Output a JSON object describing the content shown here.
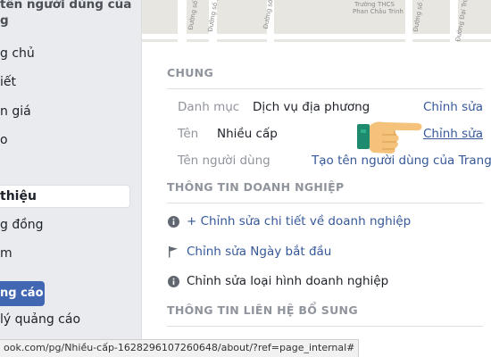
{
  "sidebar": {
    "page_title_line1": "tên người dùng của",
    "page_title_line2": "g",
    "items": [
      {
        "label": "g chủ"
      },
      {
        "label": "iết"
      },
      {
        "label": "n giá"
      },
      {
        "label": "o"
      }
    ],
    "active_item": "thiệu",
    "items_after": [
      {
        "label": "g đồng"
      },
      {
        "label": "m"
      }
    ],
    "promo_button": "ng cáo",
    "manage_ads": "lý quảng cáo"
  },
  "map": {
    "labels": [
      "Đường số 6",
      "Đường số 5",
      "Đường số",
      "Trường THCS",
      "Phan Châu Trinh",
      "Đường Đại Trong",
      "Đường số 3"
    ]
  },
  "general": {
    "heading": "CHUNG",
    "rows": [
      {
        "label": "Danh mục",
        "value": "Dịch vụ địa phương",
        "action": "Chỉnh sửa"
      },
      {
        "label": "Tên",
        "value": "Nhiều cấp",
        "action": "Chỉnh sửa"
      },
      {
        "label": "Tên người dùng",
        "value": "",
        "action": "Tạo tên người dùng của Trang"
      }
    ]
  },
  "business_info": {
    "heading": "THÔNG TIN DOANH NGHIỆP",
    "items": [
      {
        "icon": "info-icon",
        "text": "+ Chỉnh sửa chi tiết về doanh nghiệp"
      },
      {
        "icon": "flag-icon",
        "text": "Chỉnh sửa Ngày bắt đầu"
      },
      {
        "icon": "info-icon",
        "text": "Chỉnh sửa loại hình doanh nghiệp"
      }
    ]
  },
  "additional_contact": {
    "heading": "THÔNG TIN LIÊN HỆ BỔ SUNG"
  },
  "status_url": "ook.com/pg/Nhiều-cấp-1628296107260648/about/?ref=page_internal#",
  "colors": {
    "link": "#365899",
    "muted": "#90949c",
    "accent": "#4267b2",
    "hand_skin": "#f4c27a",
    "hand_cuff": "#1e8a6e"
  }
}
